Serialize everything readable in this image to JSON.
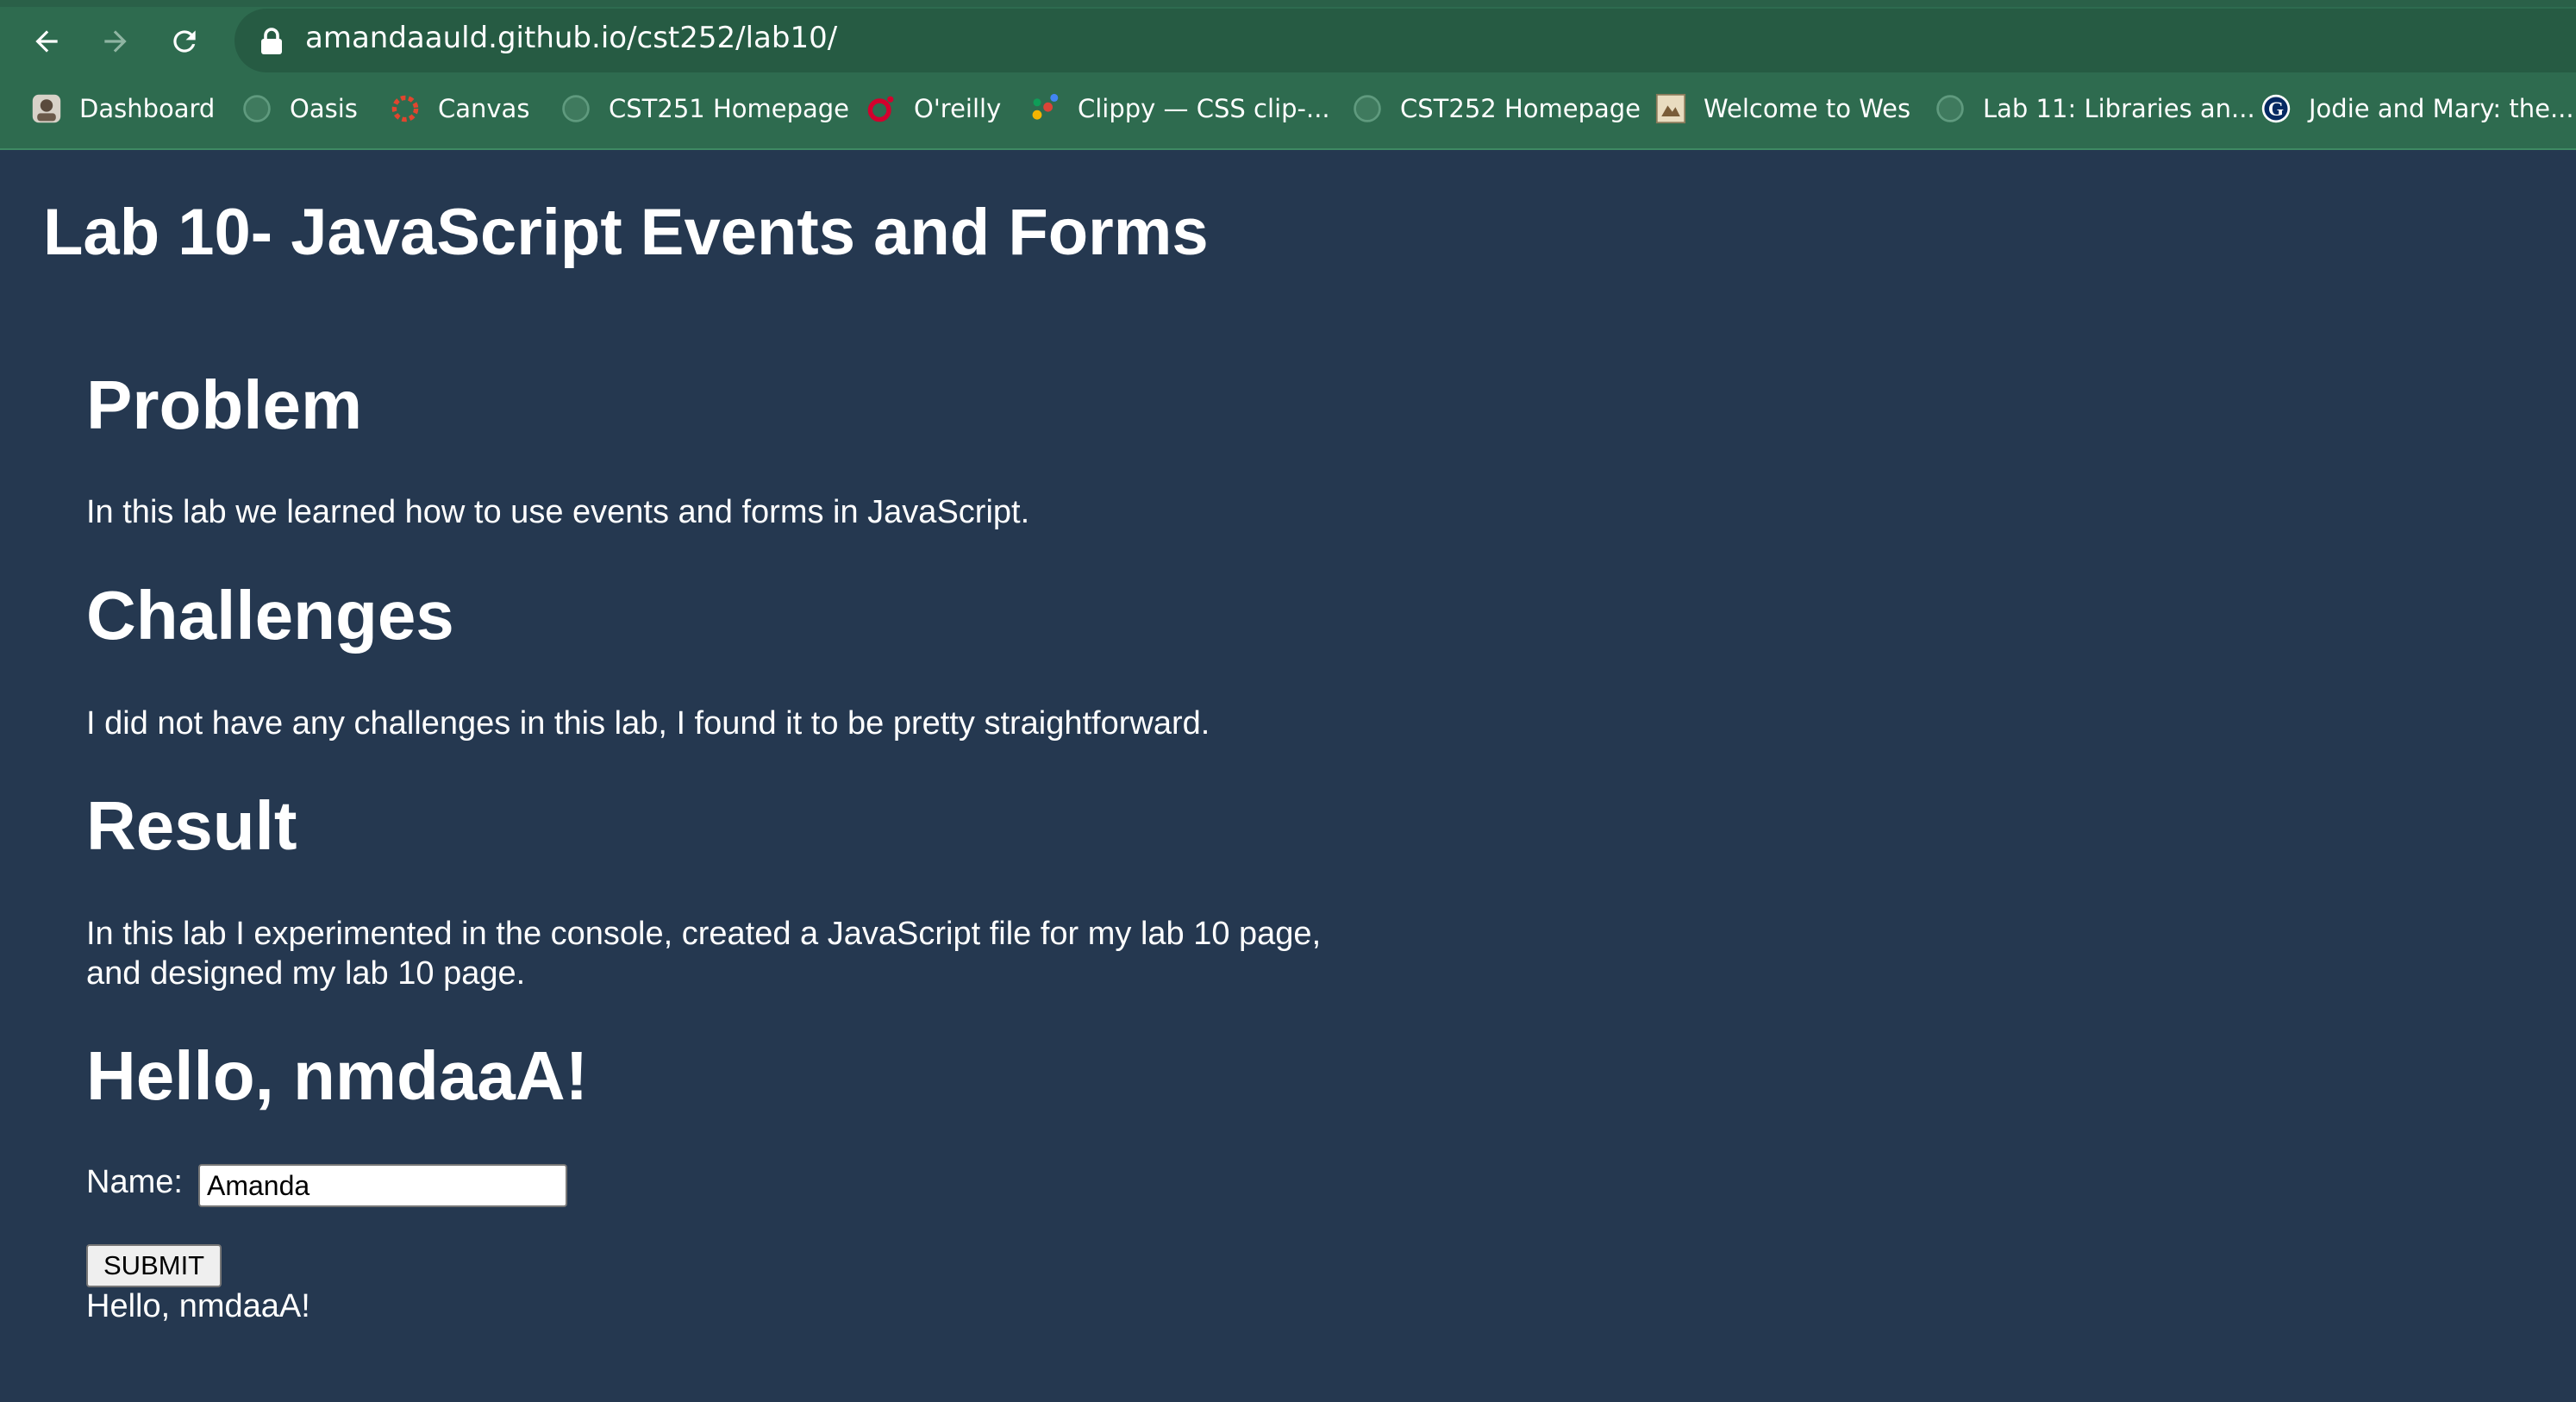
{
  "browser": {
    "url": "amandaauld.github.io/cst252/lab10/",
    "bookmarks": [
      {
        "label": "Dashboard",
        "icon": "dashboard-avatar-icon"
      },
      {
        "label": "Oasis",
        "icon": "globe-icon"
      },
      {
        "label": "Canvas",
        "icon": "canvas-logo-icon"
      },
      {
        "label": "CST251 Homepage",
        "icon": "globe-icon"
      },
      {
        "label": "O'reilly",
        "icon": "oreilly-logo-icon"
      },
      {
        "label": "Clippy — CSS clip-...",
        "icon": "clippy-dots-icon"
      },
      {
        "label": "CST252 Homepage",
        "icon": "globe-icon"
      },
      {
        "label": "Welcome to Wes",
        "icon": "wes-thumbnail-icon"
      },
      {
        "label": "Lab 11: Libraries an...",
        "icon": "globe-icon"
      },
      {
        "label": "Jodie and Mary: the...",
        "icon": "guardian-logo-icon"
      }
    ],
    "colors": {
      "chrome": "#2e6b4f",
      "omnibox": "#265b43"
    }
  },
  "page": {
    "title": "Lab 10- JavaScript Events and Forms",
    "sections": [
      {
        "heading": "Problem",
        "text": "In this lab we learned how to use events and forms in JavaScript."
      },
      {
        "heading": "Challenges",
        "text": "I did not have any challenges in this lab, I found it to be pretty straightforward."
      },
      {
        "heading": "Result",
        "text": "In this lab I experimented in the console, created a JavaScript file for my lab 10 page, and designed my lab 10 page."
      }
    ],
    "greeting_heading": "Hello, nmdaaA!",
    "form": {
      "name_label": "Name:",
      "name_value": "Amanda",
      "submit_label": "SUBMIT"
    },
    "output_text": "Hello, nmdaaA!",
    "colors": {
      "background": "#253850",
      "text": "#ffffff"
    }
  }
}
